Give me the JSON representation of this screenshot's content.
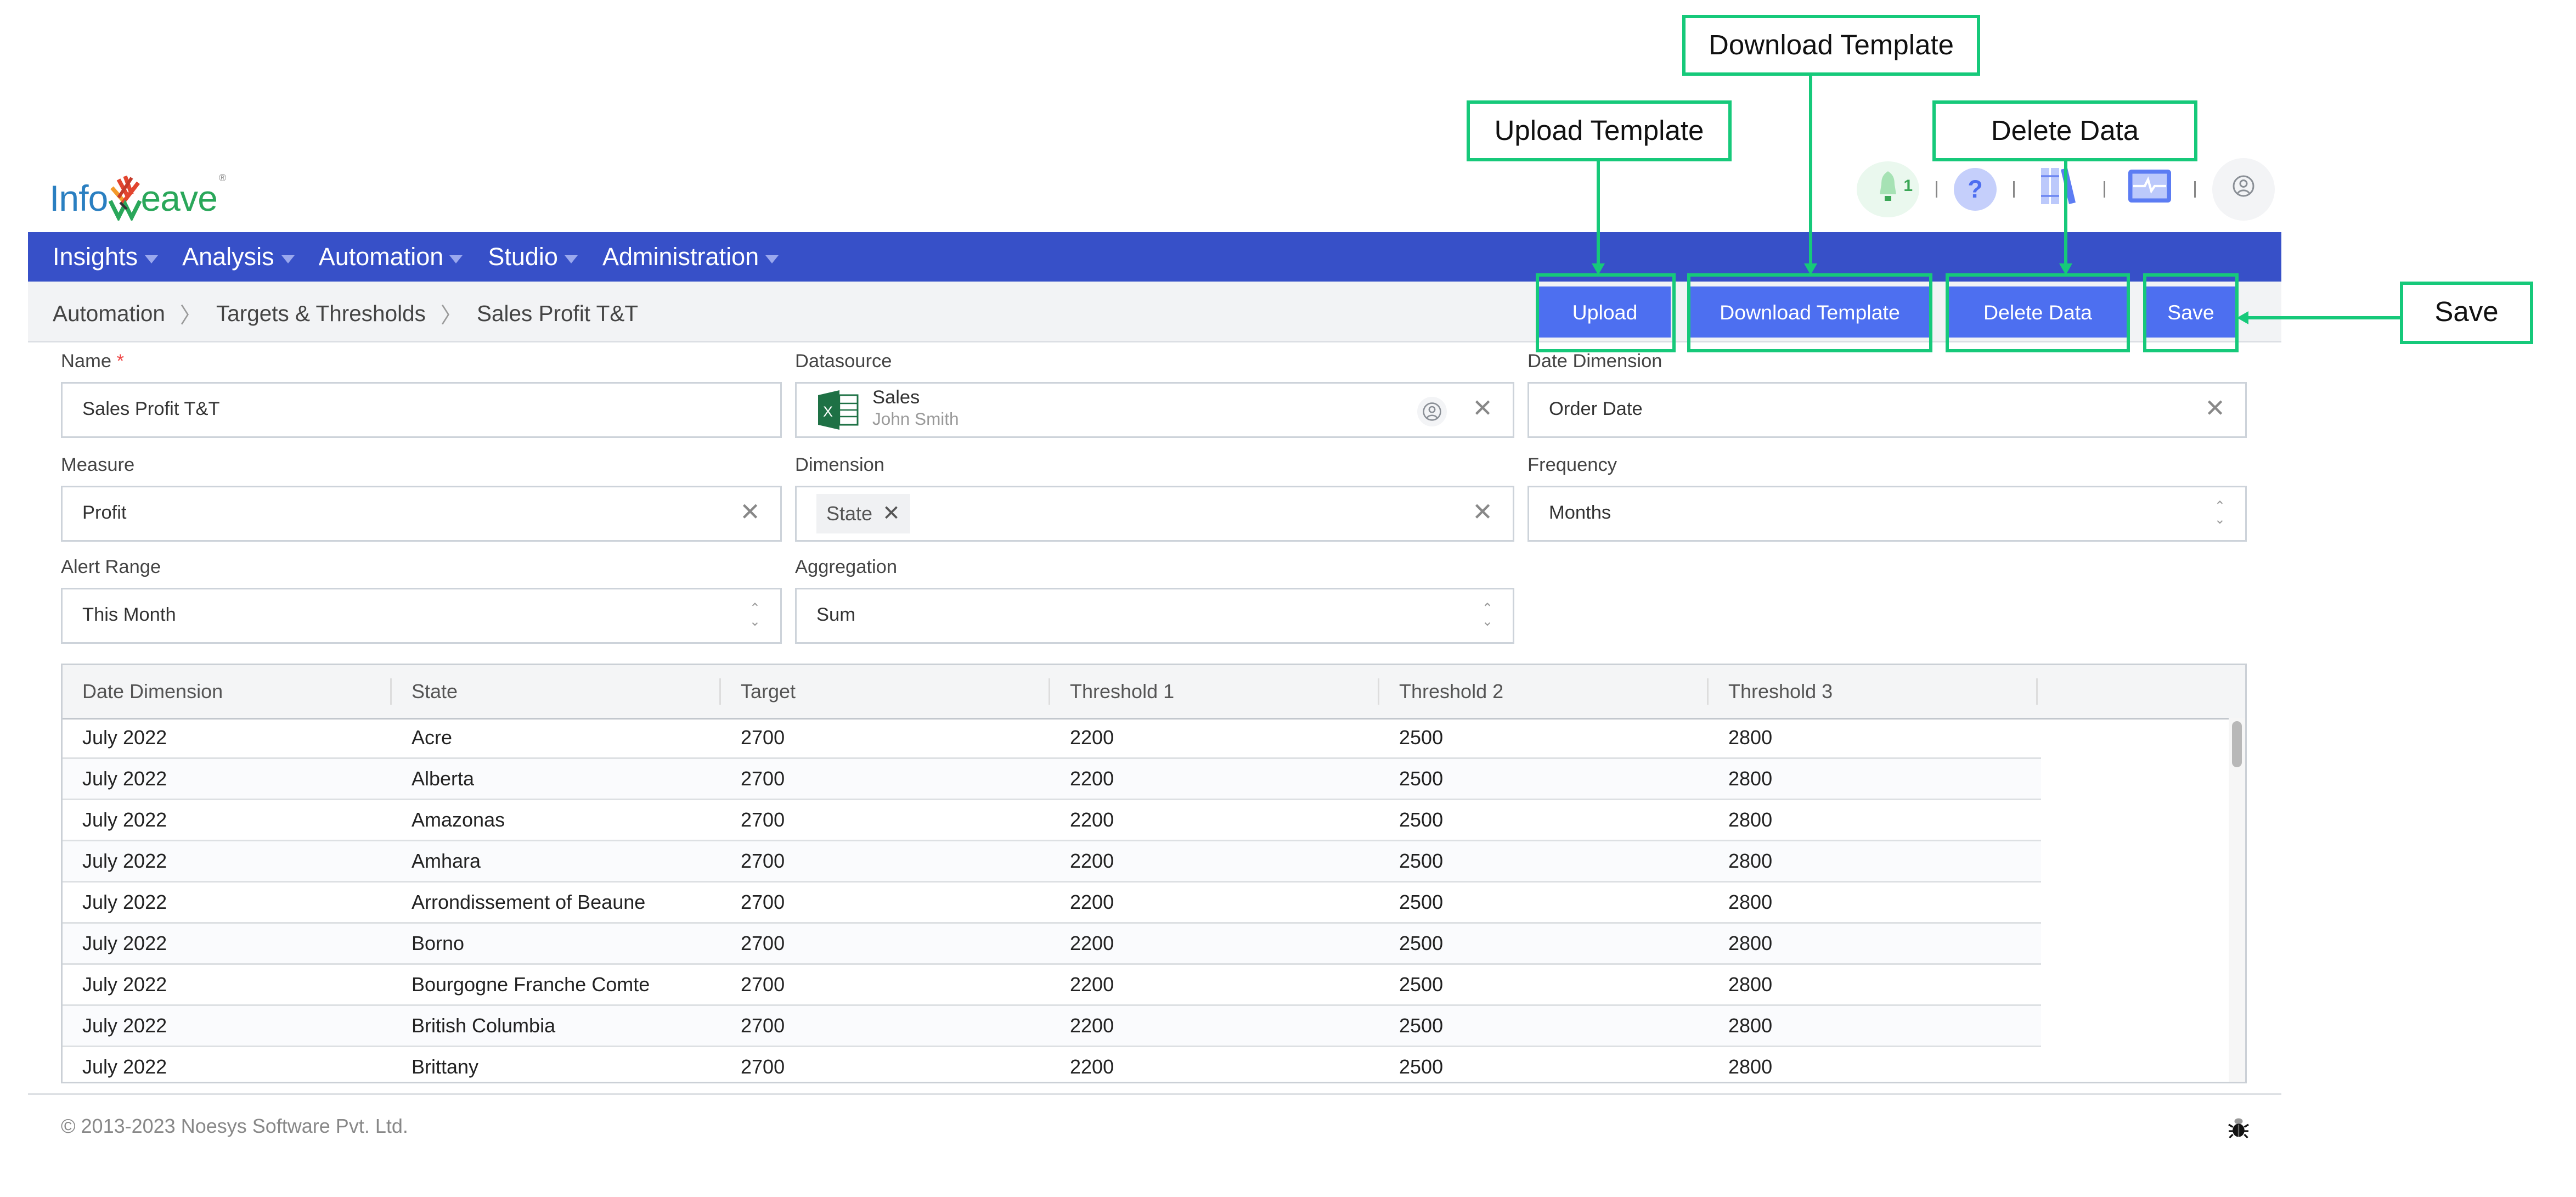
{
  "app": {
    "logo_prefix": "Info",
    "logo_suffix": "eave",
    "logo_mark": "W"
  },
  "header_icons": {
    "notifications_count": "1",
    "help_glyph": "?"
  },
  "nav": {
    "items": [
      {
        "label": "Insights"
      },
      {
        "label": "Analysis"
      },
      {
        "label": "Automation"
      },
      {
        "label": "Studio"
      },
      {
        "label": "Administration"
      }
    ]
  },
  "breadcrumb": [
    "Automation",
    "Targets & Thresholds",
    "Sales Profit T&T"
  ],
  "toolbar": {
    "upload_label": "Upload",
    "download_template_label": "Download Template",
    "delete_data_label": "Delete Data",
    "save_label": "Save"
  },
  "form": {
    "name": {
      "label": "Name",
      "required_mark": "*",
      "value": "Sales Profit T&T"
    },
    "datasource": {
      "label": "Datasource",
      "name": "Sales",
      "owner": "John Smith"
    },
    "date_dimension": {
      "label": "Date Dimension",
      "value": "Order Date"
    },
    "measure": {
      "label": "Measure",
      "value": "Profit"
    },
    "dimension": {
      "label": "Dimension",
      "chips": [
        "State"
      ]
    },
    "frequency": {
      "label": "Frequency",
      "value": "Months"
    },
    "alert_range": {
      "label": "Alert Range",
      "value": "This Month"
    },
    "aggregation": {
      "label": "Aggregation",
      "value": "Sum"
    }
  },
  "table": {
    "columns": [
      "Date Dimension",
      "State",
      "Target",
      "Threshold 1",
      "Threshold 2",
      "Threshold 3"
    ],
    "rows": [
      [
        "July 2022",
        "Acre",
        "2700",
        "2200",
        "2500",
        "2800"
      ],
      [
        "July 2022",
        "Alberta",
        "2700",
        "2200",
        "2500",
        "2800"
      ],
      [
        "July 2022",
        "Amazonas",
        "2700",
        "2200",
        "2500",
        "2800"
      ],
      [
        "July 2022",
        "Amhara",
        "2700",
        "2200",
        "2500",
        "2800"
      ],
      [
        "July 2022",
        "Arrondissement of Beaune",
        "2700",
        "2200",
        "2500",
        "2800"
      ],
      [
        "July 2022",
        "Borno",
        "2700",
        "2200",
        "2500",
        "2800"
      ],
      [
        "July 2022",
        "Bourgogne Franche Comte",
        "2700",
        "2200",
        "2500",
        "2800"
      ],
      [
        "July 2022",
        "British Columbia",
        "2700",
        "2200",
        "2500",
        "2800"
      ],
      [
        "July 2022",
        "Brittany",
        "2700",
        "2200",
        "2500",
        "2800"
      ]
    ]
  },
  "footer": {
    "copyright": "© 2013-2023 Noesys Software Pvt. Ltd."
  },
  "annotations": {
    "upload_template": "Upload Template",
    "download_template": "Download Template",
    "delete_data": "Delete Data",
    "save": "Save"
  },
  "colors": {
    "nav_bg": "#3750c8",
    "button_bg": "#4d6ff0",
    "annotation": "#16c97a"
  }
}
